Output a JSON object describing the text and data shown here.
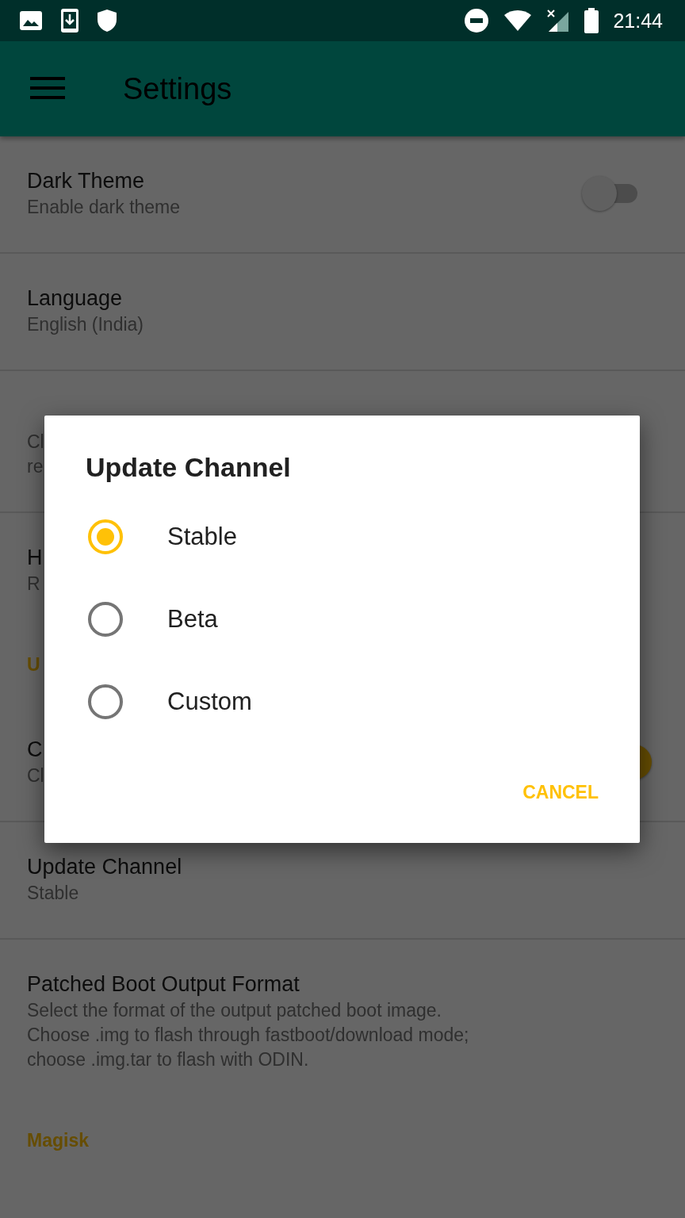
{
  "status_bar": {
    "time": "21:44"
  },
  "app_bar": {
    "title": "Settings"
  },
  "preferences": [
    {
      "kind": "item",
      "title": "Dark Theme",
      "summary": [
        "Enable dark theme"
      ],
      "switch": {
        "on": false
      }
    },
    {
      "kind": "item",
      "title": "Language",
      "summary": [
        "English (India)"
      ]
    },
    {
      "kind": "item",
      "summary": [
        "Cl",
        "re"
      ]
    },
    {
      "kind": "item",
      "title": "H",
      "summary": [
        "R"
      ]
    },
    {
      "kind": "section",
      "title": "U"
    },
    {
      "kind": "item",
      "title": "C",
      "summary": [
        "Cl"
      ],
      "switch": {
        "on": true
      }
    },
    {
      "kind": "item",
      "title": "Update Channel",
      "summary": [
        "Stable"
      ]
    },
    {
      "kind": "item",
      "title": "Patched Boot Output Format",
      "summary": [
        "Select the format of the output patched boot image.",
        "Choose .img to flash through fastboot/download mode;",
        "choose .img.tar to flash with ODIN."
      ]
    },
    {
      "kind": "section",
      "title": "Magisk"
    }
  ],
  "dialog": {
    "title": "Update Channel",
    "options": [
      {
        "label": "Stable",
        "selected": true
      },
      {
        "label": "Beta",
        "selected": false
      },
      {
        "label": "Custom",
        "selected": false
      }
    ],
    "buttons": [
      "CANCEL"
    ]
  }
}
